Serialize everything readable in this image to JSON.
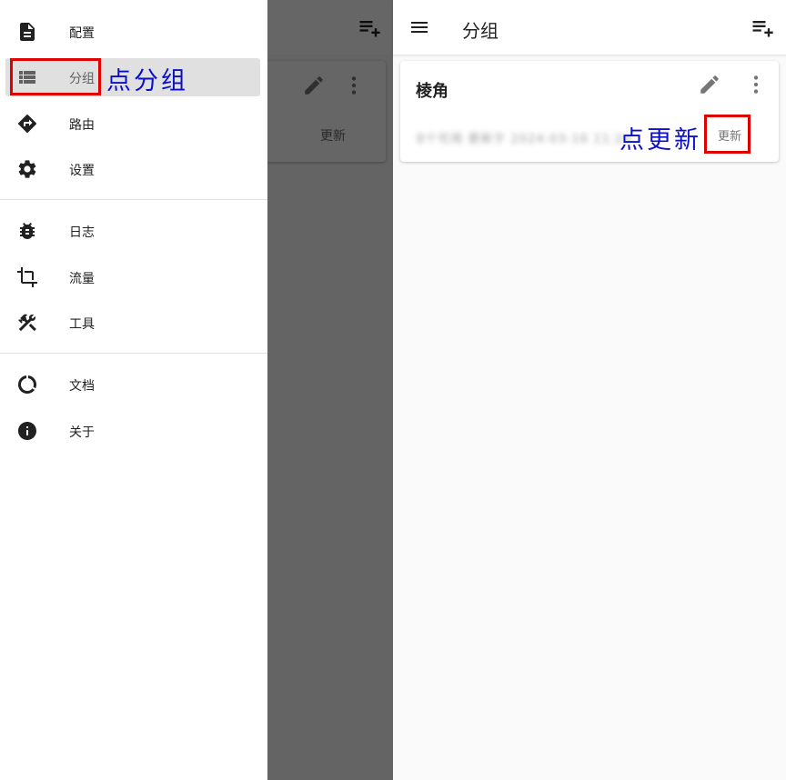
{
  "drawer": {
    "items": [
      {
        "label": "配置",
        "icon": "document-icon"
      },
      {
        "label": "分组",
        "icon": "list-icon",
        "active": true
      },
      {
        "label": "路由",
        "icon": "route-icon"
      },
      {
        "label": "设置",
        "icon": "gear-icon"
      },
      {
        "label": "日志",
        "icon": "bug-icon"
      },
      {
        "label": "流量",
        "icon": "crop-icon"
      },
      {
        "label": "工具",
        "icon": "tools-icon"
      },
      {
        "label": "文档",
        "icon": "donut-icon"
      },
      {
        "label": "关于",
        "icon": "info-icon"
      }
    ]
  },
  "background_card": {
    "update_label": "更新"
  },
  "annotations": {
    "click_group": "点分组",
    "click_update": "点更新",
    "highlight_color": "#e00000",
    "text_color": "#0b10c8"
  },
  "appbar": {
    "title": "分组"
  },
  "group_card": {
    "name": "棱角",
    "subtitle": "8个可用 更新于 2024-03-16 11:24",
    "update_label": "更新"
  }
}
